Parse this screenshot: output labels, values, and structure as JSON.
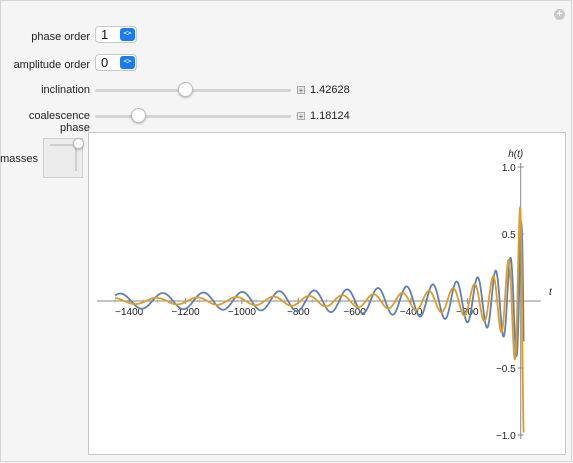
{
  "controls": {
    "phase_order": {
      "label": "phase order",
      "value": "1"
    },
    "amplitude_order": {
      "label": "amplitude order",
      "value": "0"
    },
    "inclination": {
      "label": "inclination",
      "value": "1.42628",
      "fraction": 0.46
    },
    "coalescence_phase": {
      "label": "coalescence phase",
      "value": "1.18124",
      "fraction": 0.22
    },
    "masses": {
      "label": "masses"
    }
  },
  "chart_data": {
    "type": "line",
    "xlabel": "t",
    "ylabel": "h(t)",
    "xlim": [
      -1500,
      40
    ],
    "ylim": [
      -1.0,
      1.0
    ],
    "xticks": [
      "-1400",
      "-1200",
      "-1000",
      "-800",
      "-600",
      "-400",
      "-200"
    ],
    "xtick_values": [
      -1400,
      -1200,
      -1000,
      -800,
      -600,
      -400,
      -200
    ],
    "yticks": [
      "1.0",
      "0.5",
      "-0.5",
      "-1.0"
    ],
    "ytick_values": [
      1.0,
      0.5,
      -0.5,
      -1.0
    ],
    "grid": false,
    "series": [
      {
        "color": "#5e81b5",
        "amplitude_start": 0.045,
        "amplitude_end": 1.0,
        "cycles_approx": 30
      },
      {
        "color": "#e19c24",
        "amplitude_start": 0.018,
        "amplitude_end": 1.0,
        "cycles_approx": 30
      }
    ]
  }
}
